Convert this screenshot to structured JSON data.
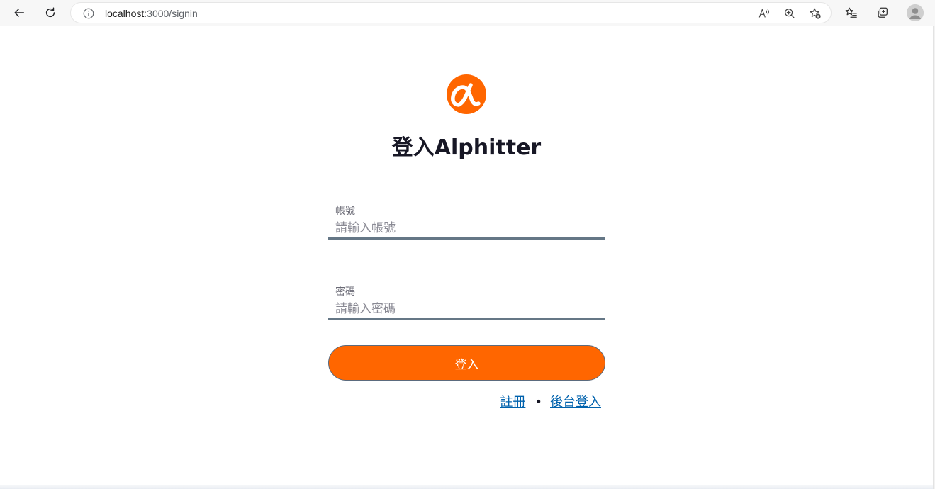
{
  "browser": {
    "url_host": "localhost",
    "url_rest": ":3000/signin",
    "icons": {
      "back": "arrow-left-icon",
      "reload": "reload-icon",
      "site_info": "info-icon",
      "read_aloud": "read-aloud-icon",
      "zoom": "zoom-in-icon",
      "add_favorite": "star-plus-icon",
      "favorites": "favorites-list-icon",
      "collections": "collections-icon",
      "profile": "profile-avatar-icon"
    }
  },
  "page": {
    "logo_icon": "alpha-logo",
    "title": "登入Alphitter",
    "account": {
      "label": "帳號",
      "placeholder": "請輸入帳號"
    },
    "password": {
      "label": "密碼",
      "placeholder": "請輸入密碼"
    },
    "login_button": "登入",
    "links": {
      "register": "註冊",
      "separator": "•",
      "admin_login": "後台登入"
    }
  },
  "colors": {
    "brand": "#ff6600",
    "link": "#0062ad",
    "input_underline": "#657786",
    "title_text": "#171725"
  }
}
